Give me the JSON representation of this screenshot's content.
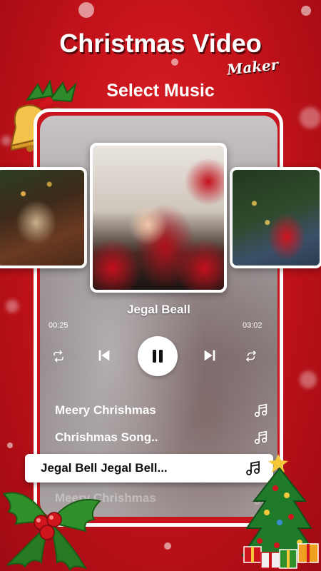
{
  "header": {
    "title": "Christmas Video",
    "title_script": "Maker",
    "section_title": "Select Music"
  },
  "player": {
    "now_playing": "Jegal Beall",
    "elapsed": "00:25",
    "duration": "03:02",
    "controls": [
      "repeat-icon",
      "previous-icon",
      "pause-icon",
      "next-icon",
      "shuffle-icon"
    ]
  },
  "tracks": [
    {
      "title": "Meery Chrishmas",
      "icon": "music-note-icon",
      "selected": false
    },
    {
      "title": "Chrishmas Song..",
      "icon": "music-note-icon",
      "selected": false
    },
    {
      "title": "Jegal Bell Jegal Bell...",
      "icon": "music-note-icon",
      "selected": true
    },
    {
      "title": "Meery Chrishmas",
      "icon": "music-note-icon",
      "selected": false
    }
  ],
  "colors": {
    "background": "#c8141c",
    "frame": "#ffffff",
    "text": "#ffffff",
    "selected_text": "#111111"
  }
}
